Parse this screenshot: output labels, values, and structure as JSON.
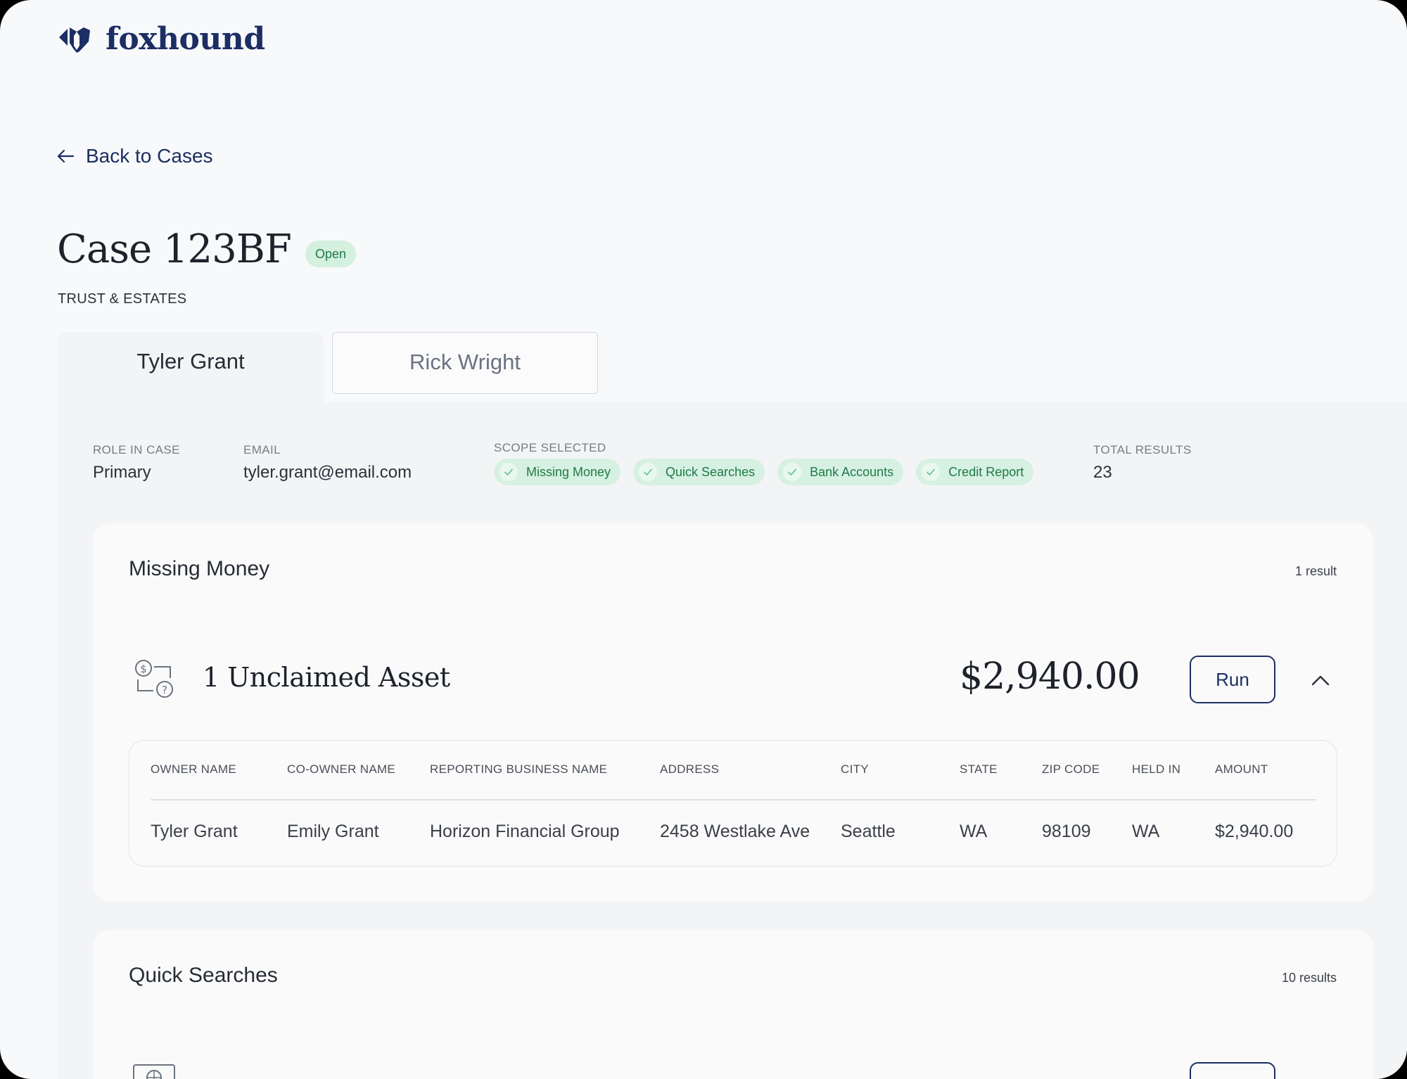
{
  "brand": {
    "name": "foxhound",
    "color": "#1c2e63"
  },
  "nav": {
    "back_label": "Back to Cases",
    "back_icon": "arrow-left-icon"
  },
  "case": {
    "title": "Case 123BF",
    "status": "Open",
    "type": "TRUST & ESTATES"
  },
  "tabs": [
    {
      "label": "Tyler Grant",
      "active": true
    },
    {
      "label": "Rick Wright",
      "active": false
    }
  ],
  "person": {
    "role_label": "ROLE IN CASE",
    "role_value": "Primary",
    "email_label": "EMAIL",
    "email_value": "tyler.grant@email.com",
    "scope_label": "SCOPE SELECTED",
    "scope": [
      "Missing Money",
      "Quick Searches",
      "Bank Accounts",
      "Credit Report"
    ],
    "total_label": "TOTAL RESULTS",
    "total_value": "23"
  },
  "sections": [
    {
      "title": "Missing Money",
      "count": "1 result",
      "asset_title": "1 Unclaimed Asset",
      "amount": "$2,940.00",
      "run_label": "Run",
      "table": {
        "headers": [
          "OWNER NAME",
          "CO-OWNER NAME",
          "REPORTING BUSINESS NAME",
          "ADDRESS",
          "CITY",
          "STATE",
          "ZIP CODE",
          "HELD IN",
          "AMOUNT"
        ],
        "rows": [
          [
            "Tyler Grant",
            "Emily Grant",
            "Horizon Financial Group",
            "2458 Westlake Ave",
            "Seattle",
            "WA",
            "98109",
            "WA",
            "$2,940.00"
          ]
        ]
      }
    },
    {
      "title": "Quick Searches",
      "count": "10 results"
    }
  ],
  "colors": {
    "status_green": "#1f7a49",
    "chip_bg": "#d6f1e1",
    "brand_navy": "#1c2e63"
  }
}
